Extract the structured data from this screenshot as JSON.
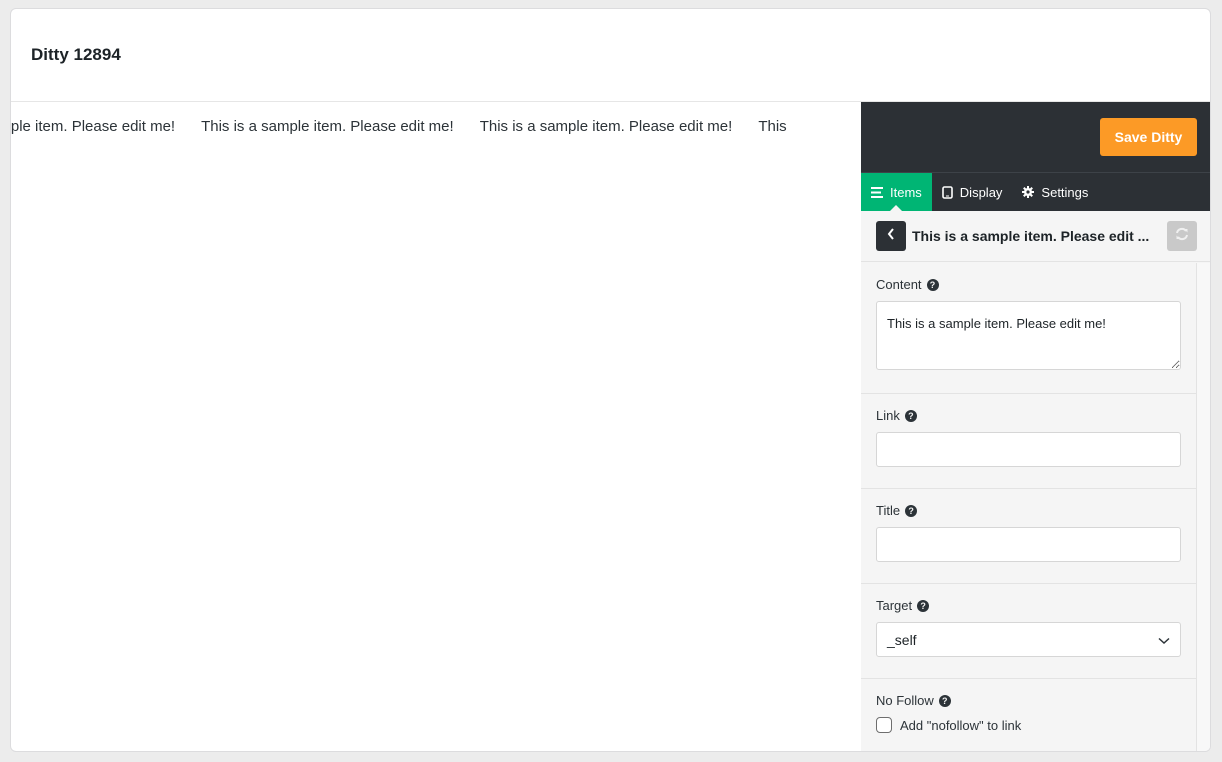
{
  "header": {
    "title": "Ditty 12894"
  },
  "preview": {
    "ticker_items": [
      "is a sample item. Please edit me!",
      "This is a sample item. Please edit me!",
      "This is a sample item. Please edit me!",
      "This"
    ]
  },
  "panel": {
    "save_label": "Save Ditty",
    "tabs": [
      {
        "label": "Items",
        "icon": "list-icon",
        "active": true
      },
      {
        "label": "Display",
        "icon": "tablet-icon",
        "active": false
      },
      {
        "label": "Settings",
        "icon": "gear-icon",
        "active": false
      }
    ],
    "item_title": "This is a sample item. Please edit ...",
    "fields": {
      "content": {
        "label": "Content",
        "value": "This is a sample item. Please edit me!"
      },
      "link": {
        "label": "Link",
        "value": ""
      },
      "title": {
        "label": "Title",
        "value": ""
      },
      "target": {
        "label": "Target",
        "value": "_self"
      },
      "nofollow": {
        "label": "No Follow",
        "checkbox_label": "Add \"nofollow\" to link",
        "checked": false
      }
    }
  },
  "colors": {
    "accent": "#00b574",
    "save": "#fc9a26",
    "dark": "#2c3035"
  }
}
